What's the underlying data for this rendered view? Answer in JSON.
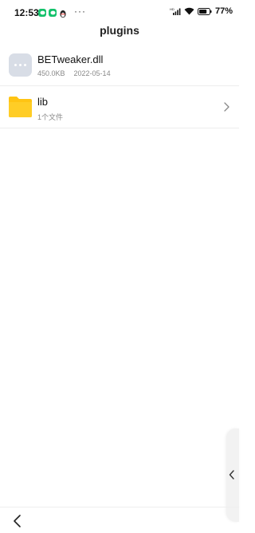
{
  "status_bar": {
    "time": "12:53",
    "more": "···",
    "battery_percent": "77%",
    "icons": [
      "wechat-icon",
      "wechat-icon",
      "qq-icon",
      "signal-icon",
      "wifi-icon",
      "battery-icon"
    ]
  },
  "header": {
    "title": "plugins"
  },
  "files": [
    {
      "name": "BETweaker.dll",
      "size": "450.0KB",
      "date": "2022-05-14",
      "icon": "dll-file-icon"
    },
    {
      "name": "lib",
      "meta": "1个文件",
      "icon": "folder-icon"
    }
  ],
  "colors": {
    "wechat_green": "#13c16b",
    "folder_yellow": "#ffc413",
    "dll_gray": "#d8dde6"
  },
  "battery_level": 0.77
}
